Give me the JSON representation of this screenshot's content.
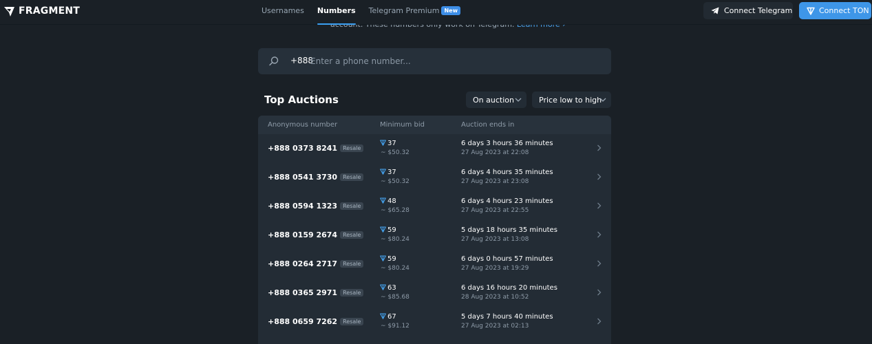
{
  "brand": {
    "name": "FRAGMENT"
  },
  "nav": {
    "items": [
      {
        "label": "Usernames",
        "active": false
      },
      {
        "label": "Numbers",
        "active": true
      },
      {
        "label": "Telegram Premium",
        "active": false,
        "badge": "New"
      }
    ]
  },
  "header": {
    "connect_telegram": "Connect Telegram",
    "connect_ton": "Connect TON"
  },
  "intro": {
    "text": "account. These numbers only work on Telegram.",
    "link": "Learn more"
  },
  "search": {
    "prefix": "+888",
    "placeholder": "Enter a phone number...",
    "value": ""
  },
  "auctions": {
    "title": "Top Auctions",
    "filter_status": "On auction",
    "sort": "Price low to high",
    "columns": [
      "Anonymous number",
      "Minimum bid",
      "Auction ends in"
    ],
    "rows": [
      {
        "number": "+888 0373 8241",
        "tag": "Resale",
        "bid": "37",
        "usd": "~ $50.32",
        "ends": "6 days 3 hours 36 minutes",
        "date": "27 Aug 2023 at 22:08"
      },
      {
        "number": "+888 0541 3730",
        "tag": "Resale",
        "bid": "37",
        "usd": "~ $50.32",
        "ends": "6 days 4 hours 35 minutes",
        "date": "27 Aug 2023 at 23:08"
      },
      {
        "number": "+888 0594 1323",
        "tag": "Resale",
        "bid": "48",
        "usd": "~ $65.28",
        "ends": "6 days 4 hours 23 minutes",
        "date": "27 Aug 2023 at 22:55"
      },
      {
        "number": "+888 0159 2674",
        "tag": "Resale",
        "bid": "59",
        "usd": "~ $80.24",
        "ends": "5 days 18 hours 35 minutes",
        "date": "27 Aug 2023 at 13:08"
      },
      {
        "number": "+888 0264 2717",
        "tag": "Resale",
        "bid": "59",
        "usd": "~ $80.24",
        "ends": "6 days 0 hours 57 minutes",
        "date": "27 Aug 2023 at 19:29"
      },
      {
        "number": "+888 0365 2971",
        "tag": "Resale",
        "bid": "63",
        "usd": "~ $85.68",
        "ends": "6 days 16 hours 20 minutes",
        "date": "28 Aug 2023 at 10:52"
      },
      {
        "number": "+888 0659 7262",
        "tag": "Resale",
        "bid": "67",
        "usd": "~ $91.12",
        "ends": "5 days 7 hours 40 minutes",
        "date": "27 Aug 2023 at 02:13"
      }
    ]
  },
  "colors": {
    "accent": "#3e96e8",
    "background": "#1a2026",
    "panel": "#232c35"
  }
}
